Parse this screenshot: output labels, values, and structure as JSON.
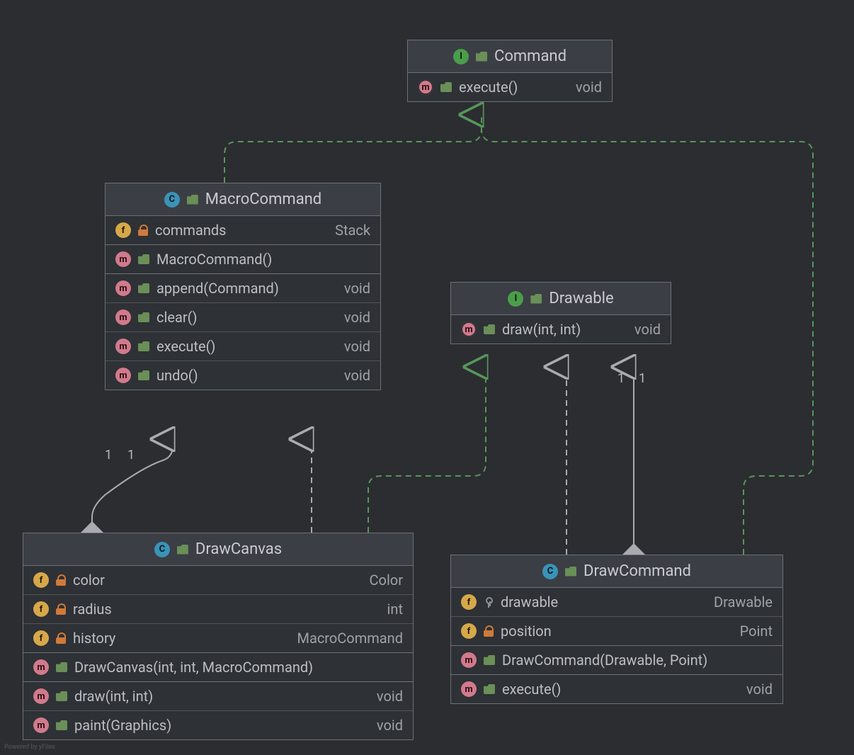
{
  "footer": "Powered by yFiles",
  "classes": {
    "command": {
      "kind": "I",
      "name": "Command",
      "members": [
        {
          "icon": "m",
          "abstract": true,
          "vis": "folder",
          "sig": "execute()",
          "ret": "void"
        }
      ]
    },
    "macroCommand": {
      "kind": "C",
      "name": "MacroCommand",
      "fields": [
        {
          "icon": "f",
          "vis": "lock",
          "sig": "commands",
          "ret": "Stack"
        }
      ],
      "ctors": [
        {
          "icon": "m",
          "vis": "folder",
          "sig": "MacroCommand()"
        }
      ],
      "methods": [
        {
          "icon": "m",
          "vis": "folder",
          "sig": "append(Command)",
          "ret": "void"
        },
        {
          "icon": "m",
          "vis": "folder",
          "sig": "clear()",
          "ret": "void"
        },
        {
          "icon": "m",
          "vis": "folder",
          "sig": "execute()",
          "ret": "void"
        },
        {
          "icon": "m",
          "vis": "folder",
          "sig": "undo()",
          "ret": "void"
        }
      ]
    },
    "drawable": {
      "kind": "I",
      "name": "Drawable",
      "members": [
        {
          "icon": "m",
          "abstract": true,
          "vis": "folder",
          "sig": "draw(int, int)",
          "ret": "void"
        }
      ]
    },
    "drawCanvas": {
      "kind": "C",
      "name": "DrawCanvas",
      "fields": [
        {
          "icon": "f",
          "vis": "lock",
          "sig": "color",
          "ret": "Color"
        },
        {
          "icon": "f",
          "vis": "lock",
          "sig": "radius",
          "ret": "int"
        },
        {
          "icon": "f",
          "vis": "lock",
          "sig": "history",
          "ret": "MacroCommand"
        }
      ],
      "ctors": [
        {
          "icon": "m",
          "vis": "folder",
          "sig": "DrawCanvas(int, int, MacroCommand)"
        }
      ],
      "methods": [
        {
          "icon": "m",
          "vis": "folder",
          "sig": "draw(int, int)",
          "ret": "void"
        },
        {
          "icon": "m",
          "vis": "folder",
          "sig": "paint(Graphics)",
          "ret": "void"
        }
      ]
    },
    "drawCommand": {
      "kind": "C",
      "name": "DrawCommand",
      "fields": [
        {
          "icon": "f",
          "vis": "key",
          "sig": "drawable",
          "ret": "Drawable"
        },
        {
          "icon": "f",
          "vis": "lock",
          "sig": "position",
          "ret": "Point"
        }
      ],
      "ctors": [
        {
          "icon": "m",
          "vis": "folder",
          "sig": "DrawCommand(Drawable, Point)"
        }
      ],
      "methods": [
        {
          "icon": "m",
          "vis": "folder",
          "sig": "execute()",
          "ret": "void"
        }
      ]
    }
  },
  "edgeLabels": {
    "canvasMacro": {
      "a": "1",
      "b": "1"
    },
    "cmdDrawable": {
      "a": "1",
      "b": "1"
    }
  }
}
